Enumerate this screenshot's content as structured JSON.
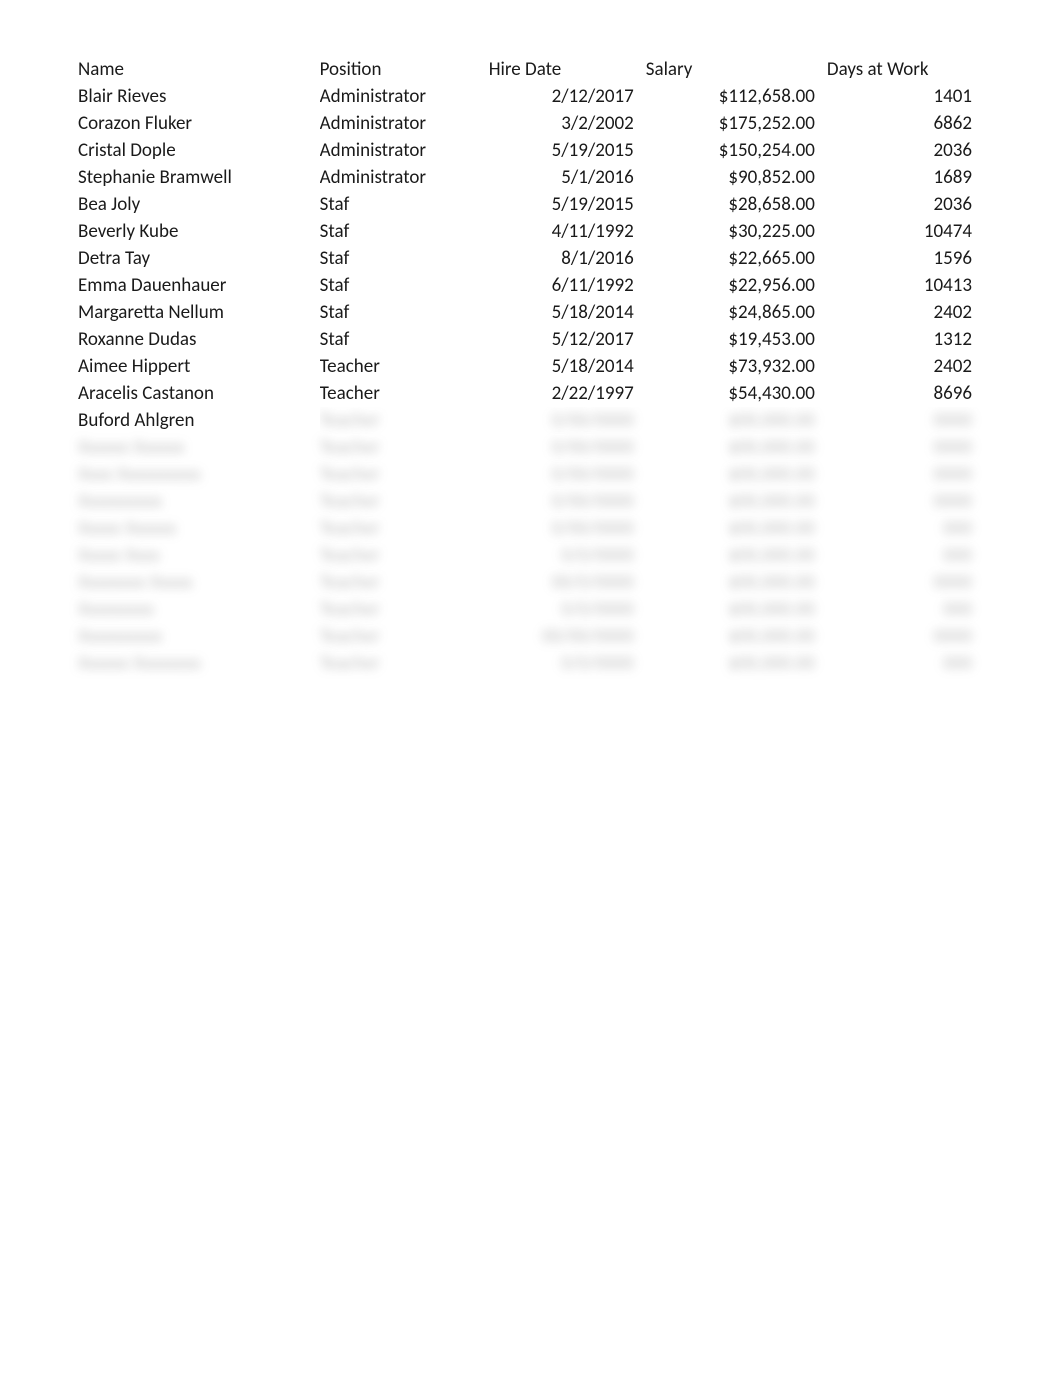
{
  "headers": {
    "name": "Name",
    "position": "Position",
    "hire_date": "Hire Date",
    "salary": "Salary",
    "days": "Days at Work"
  },
  "rows": [
    {
      "name": "Blair Rieves",
      "position": "Administrator",
      "hire_date": "2/12/2017",
      "salary": "$112,658.00",
      "days": "1401"
    },
    {
      "name": "Corazon Fluker",
      "position": "Administrator",
      "hire_date": "3/2/2002",
      "salary": "$175,252.00",
      "days": "6862"
    },
    {
      "name": "Cristal Dople",
      "position": "Administrator",
      "hire_date": "5/19/2015",
      "salary": "$150,254.00",
      "days": "2036"
    },
    {
      "name": "Stephanie Bramwell",
      "position": "Administrator",
      "hire_date": "5/1/2016",
      "salary": "$90,852.00",
      "days": "1689"
    },
    {
      "name": "Bea Joly",
      "position": "Staf",
      "hire_date": "5/19/2015",
      "salary": "$28,658.00",
      "days": "2036"
    },
    {
      "name": "Beverly Kube",
      "position": "Staf",
      "hire_date": "4/11/1992",
      "salary": "$30,225.00",
      "days": "10474"
    },
    {
      "name": "Detra Tay",
      "position": "Staf",
      "hire_date": "8/1/2016",
      "salary": "$22,665.00",
      "days": "1596"
    },
    {
      "name": "Emma Dauenhauer",
      "position": "Staf",
      "hire_date": "6/11/1992",
      "salary": "$22,956.00",
      "days": "10413"
    },
    {
      "name": "Margaretta Nellum",
      "position": "Staf",
      "hire_date": "5/18/2014",
      "salary": "$24,865.00",
      "days": "2402"
    },
    {
      "name": "Roxanne Dudas",
      "position": "Staf",
      "hire_date": "5/12/2017",
      "salary": "$19,453.00",
      "days": "1312"
    },
    {
      "name": "Aimee Hippert",
      "position": "Teacher",
      "hire_date": "5/18/2014",
      "salary": "$73,932.00",
      "days": "2402"
    },
    {
      "name": "Aracelis Castanon",
      "position": "Teacher",
      "hire_date": "2/22/1997",
      "salary": "$54,430.00",
      "days": "8696"
    }
  ],
  "partial_row": {
    "name": "Buford Ahlgren",
    "position": "Teacher",
    "hire_date": "0/00/0000",
    "salary": "$00,000.00",
    "days": "0000"
  },
  "blurred_rows": [
    {
      "name": "Xxxxxx Xxxxxx",
      "position": "Teacher",
      "hire_date": "0/00/0000",
      "salary": "$00,000.00",
      "days": "0000"
    },
    {
      "name": "Xxxx Xxxxxxxxxx",
      "position": "Teacher",
      "hire_date": "0/00/0000",
      "salary": "$00,000.00",
      "days": "0000"
    },
    {
      "name": "Xxxxxxxxxx",
      "position": "Teacher",
      "hire_date": "0/00/0000",
      "salary": "$00,000.00",
      "days": "0000"
    },
    {
      "name": "Xxxxx Xxxxxx",
      "position": "Teacher",
      "hire_date": "0/00/0000",
      "salary": "$00,000.00",
      "days": "000"
    },
    {
      "name": "Xxxxx Xxxx",
      "position": "Teacher",
      "hire_date": "0/0/0000",
      "salary": "$00,000.00",
      "days": "000"
    },
    {
      "name": "Xxxxxxxx Xxxxx",
      "position": "Teacher",
      "hire_date": "00/0/0000",
      "salary": "$00,000.00",
      "days": "0000"
    },
    {
      "name": "Xxxxxxxxx",
      "position": "Teacher",
      "hire_date": "0/0/0000",
      "salary": "$00,000.00",
      "days": "000"
    },
    {
      "name": "Xxxxxxxxxx",
      "position": "Teacher",
      "hire_date": "00/00/0000",
      "salary": "$00,000.00",
      "days": "0000"
    },
    {
      "name": "Xxxxxx Xxxxxxxx",
      "position": "Teacher",
      "hire_date": "0/0/0000",
      "salary": "$00,000.00",
      "days": "000"
    }
  ]
}
